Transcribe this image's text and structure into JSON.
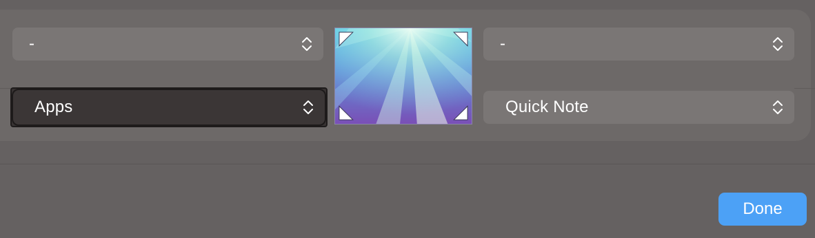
{
  "hot_corners": {
    "top_left": {
      "value": "-"
    },
    "bottom_left": {
      "value": "Apps"
    },
    "top_right": {
      "value": "-"
    },
    "bottom_right": {
      "value": "Quick Note"
    }
  },
  "preview": {
    "icon": "desktop-wallpaper-preview"
  },
  "footer": {
    "done_label": "Done"
  },
  "colors": {
    "background": "#656161",
    "panel": "#6d6968",
    "popup": "#7a7675",
    "popup_selected": "#3b3636",
    "accent": "#4ca1f6"
  }
}
